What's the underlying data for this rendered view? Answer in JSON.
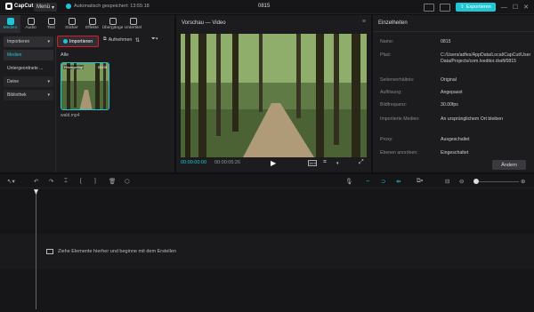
{
  "app": {
    "name": "CapCut",
    "project_title": "0815",
    "menu_label": "Menü",
    "autosave": "Automatisch gespeichert: 13:55:18",
    "export_label": "Exportieren"
  },
  "toolbar": {
    "tabs": [
      {
        "label": "Medien",
        "icon": "media-icon",
        "active": true
      },
      {
        "label": "Audio",
        "icon": "audio-icon"
      },
      {
        "label": "Text",
        "icon": "text-icon"
      },
      {
        "label": "Sticker",
        "icon": "sticker-icon"
      },
      {
        "label": "Effekte",
        "icon": "effects-icon"
      },
      {
        "label": "Übergänge",
        "icon": "transitions-icon"
      },
      {
        "label": "Untertitel",
        "icon": "subtitles-icon"
      }
    ]
  },
  "sidenav": {
    "items": [
      {
        "label": "Importieren",
        "type": "head"
      },
      {
        "label": "Medien",
        "type": "sel"
      },
      {
        "label": "Untergeordnete ...",
        "type": "plain"
      },
      {
        "label": "Deine",
        "type": "dd"
      },
      {
        "label": "Bibliothek",
        "type": "dd"
      }
    ]
  },
  "media": {
    "import_label": "Importieren",
    "record_label": "Aufnehmen",
    "filter_label": "Alle",
    "clip": {
      "name": "wald.mp4",
      "duration": "00:05",
      "badge": "Hinzugefügt"
    }
  },
  "preview": {
    "title": "Vorschau — Video",
    "time_current": "00:00:00:00",
    "time_total": "00:00:05:26",
    "ratio_label": "16:9"
  },
  "details": {
    "title": "Einzelheiten",
    "rows": [
      {
        "key": "Name:",
        "value": "0815"
      },
      {
        "key": "Pfad:",
        "value": "C:/Users/adfes/AppData/Local/CapCut/User Data/Projects/com.lveditor.draft/0815"
      },
      {
        "key": "Seitenverhältnis:",
        "value": "Original"
      },
      {
        "key": "Auflösung:",
        "value": "Angepasst"
      },
      {
        "key": "Bildfrequenz:",
        "value": "30.00fps"
      },
      {
        "key": "Importierte Medien:",
        "value": "An ursprünglichem Ort bleiben"
      },
      {
        "key": "Proxy:",
        "value": "Ausgeschaltet"
      },
      {
        "key": "Ebenen anordnen:",
        "value": "Eingeschaltet"
      }
    ],
    "change_label": "Ändern"
  },
  "timeline": {
    "drop_hint": "Ziehe Elemente hierher und beginne mit dem Erstellen"
  }
}
